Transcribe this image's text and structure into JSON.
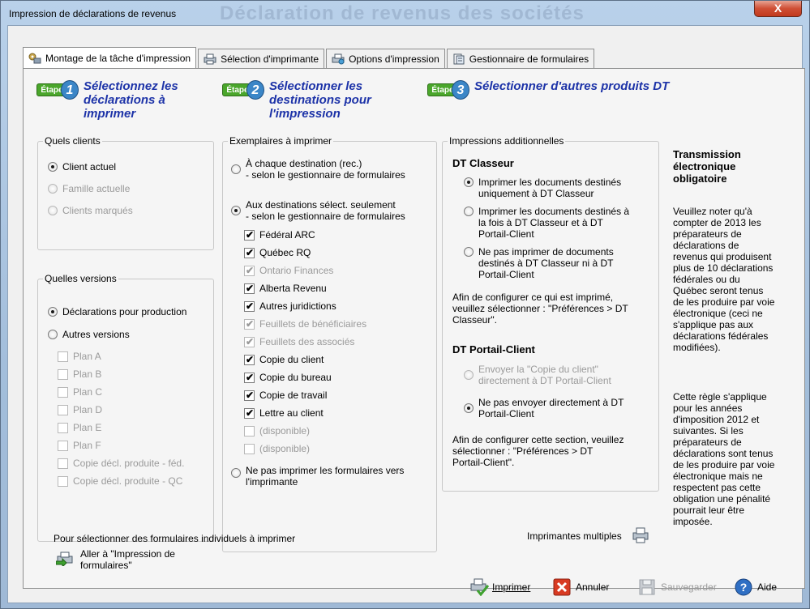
{
  "window": {
    "title": "Impression de déclarations de revenus",
    "ghost_title": "Déclaration de revenus des sociétés",
    "close_label": "X"
  },
  "tabs": [
    {
      "label": "Montage de la tâche d'impression",
      "icon": "gear-printer-icon"
    },
    {
      "label": "Sélection d'imprimante",
      "icon": "printer-icon"
    },
    {
      "label": "Options d'impression",
      "icon": "printer-options-icon"
    },
    {
      "label": "Gestionnaire de formulaires",
      "icon": "forms-icon"
    }
  ],
  "steps": [
    {
      "badge": "Étape",
      "number": "1",
      "title": "Sélectionnez les déclarations à imprimer"
    },
    {
      "badge": "Étape",
      "number": "2",
      "title": "Sélectionner les destinations pour l'impression"
    },
    {
      "badge": "Étape",
      "number": "3",
      "title": "Sélectionner d'autres produits DT"
    }
  ],
  "quels_clients": {
    "legend": "Quels clients",
    "options": [
      {
        "label": "Client actuel",
        "selected": true,
        "disabled": false
      },
      {
        "label": "Famille actuelle",
        "selected": false,
        "disabled": true
      },
      {
        "label": "Clients marqués",
        "selected": false,
        "disabled": true
      }
    ]
  },
  "quelles_versions": {
    "legend": "Quelles versions",
    "options": [
      {
        "label": "Déclarations pour production",
        "selected": true
      },
      {
        "label": "Autres versions",
        "selected": false
      }
    ],
    "plans": [
      "Plan A",
      "Plan B",
      "Plan C",
      "Plan D",
      "Plan E",
      "Plan F",
      "Copie décl. produite - féd.",
      "Copie décl. produite - QC"
    ]
  },
  "exemplaires": {
    "legend": "Exemplaires à imprimer",
    "radio1": {
      "line1": "À chaque destination (rec.)",
      "line2": "- selon le gestionnaire de formulaires",
      "selected": false
    },
    "radio2": {
      "line1": "Aux destinations sélect. seulement",
      "line2": "- selon le gestionnaire de formulaires",
      "selected": true
    },
    "checks": [
      {
        "label": "Fédéral ARC",
        "checked": true,
        "disabled": false
      },
      {
        "label": "Québec RQ",
        "checked": true,
        "disabled": false
      },
      {
        "label": "Ontario Finances",
        "checked": true,
        "disabled": true
      },
      {
        "label": "Alberta Revenu",
        "checked": true,
        "disabled": false
      },
      {
        "label": "Autres juridictions",
        "checked": true,
        "disabled": false
      },
      {
        "label": "Feuillets de bénéficiaires",
        "checked": true,
        "disabled": true
      },
      {
        "label": "Feuillets des associés",
        "checked": true,
        "disabled": true
      },
      {
        "label": "Copie du client",
        "checked": true,
        "disabled": false
      },
      {
        "label": "Copie du bureau",
        "checked": true,
        "disabled": false
      },
      {
        "label": "Copie de travail",
        "checked": true,
        "disabled": false
      },
      {
        "label": "Lettre au client",
        "checked": true,
        "disabled": false
      },
      {
        "label": "(disponible)",
        "checked": false,
        "disabled": true
      },
      {
        "label": "(disponible)",
        "checked": false,
        "disabled": true
      }
    ],
    "radio3": {
      "line1": "Ne pas imprimer les formulaires vers",
      "line2": "l'imprimante",
      "selected": false
    }
  },
  "impressions_add": {
    "legend": "Impressions additionnelles",
    "classeur_title": "DT Classeur",
    "classeur_options": [
      {
        "line1": "Imprimer les documents destinés",
        "line2": "uniquement à DT Classeur",
        "line3": "",
        "selected": true
      },
      {
        "line1": "Imprimer les documents destinés à",
        "line2": "la fois à DT Classeur et à DT",
        "line3": "Portail-Client",
        "selected": false
      },
      {
        "line1": "Ne pas imprimer de documents",
        "line2": "destinés à DT Classeur ni à DT",
        "line3": "Portail-Client",
        "selected": false
      }
    ],
    "classeur_note": [
      "Afin de configurer ce qui est imprimé,",
      "veuillez sélectionner : \"Préférences > DT",
      "Classeur\"."
    ],
    "portail_title": "DT Portail-Client",
    "portail_options": [
      {
        "line1": "Envoyer la \"Copie du client\"",
        "line2": "directement à DT Portail-Client",
        "selected": false,
        "disabled": true
      },
      {
        "line1": "Ne pas envoyer directement à DT",
        "line2": "Portail-Client",
        "selected": true,
        "disabled": false
      }
    ],
    "portail_note": [
      "Afin de configurer cette section, veuillez",
      "sélectionner : \"Préférences > DT",
      "Portail-Client\"."
    ]
  },
  "side_panel": {
    "title": [
      "Transmission",
      "électronique",
      "obligatoire"
    ],
    "para1": [
      "Veuillez noter qu'à",
      "compter de 2013 les",
      "préparateurs de",
      "déclarations de",
      "revenus qui produisent",
      "plus de 10 déclarations",
      "fédérales ou du",
      "Québec seront tenus",
      "de les produire par voie",
      "électronique (ceci ne",
      "s'applique pas aux",
      "déclarations fédérales",
      "modifiées)."
    ],
    "para2": [
      "Cette règle s'applique",
      "pour les années",
      "d'imposition 2012 et",
      "suivantes. Si les",
      "préparateurs de",
      "déclarations sont tenus",
      "de les produire par voie",
      "électronique mais ne",
      "respectent pas cette",
      "obligation une pénalité",
      "pourrait leur être",
      "imposée."
    ]
  },
  "footer_panel": {
    "individual_text": "Pour sélectionner des formulaires individuels à imprimer",
    "goto_line1": "Aller à \"Impression de",
    "goto_line2": "formulaires\"",
    "multi_printers": "Imprimantes multiples"
  },
  "buttons": {
    "print": "Imprimer",
    "cancel": "Annuler",
    "save": "Sauvegarder",
    "help": "Aide"
  },
  "colors": {
    "step_title": "#1d33a8",
    "step_badge_green": "#4aa62b",
    "step_badge_blue": "#3b86c7",
    "close_red": "#cf4f35"
  }
}
